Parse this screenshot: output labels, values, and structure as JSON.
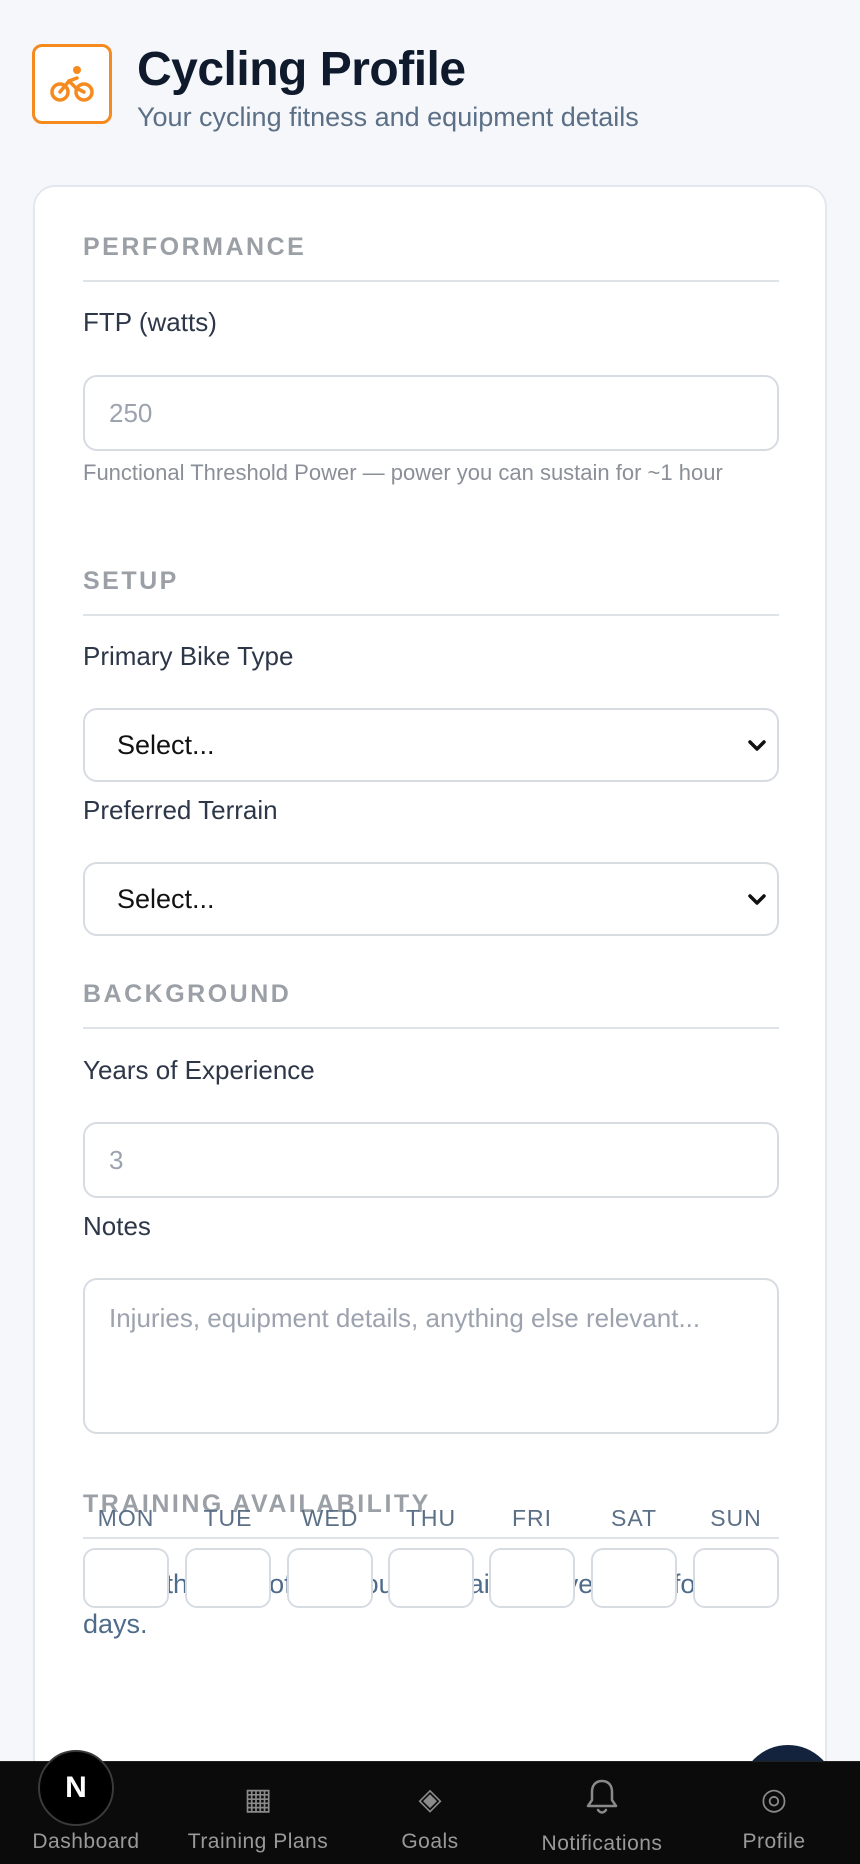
{
  "header": {
    "title": "Cycling Profile",
    "subtitle": "Your cycling fitness and equipment details",
    "icon": "bicycle-icon",
    "accent": "#f58a1f"
  },
  "form": {
    "performance": {
      "section_title": "PERFORMANCE",
      "ftp_label": "FTP (watts)",
      "ftp_placeholder": "250",
      "ftp_hint": "Functional Threshold Power — power you can sustain for ~1 hour"
    },
    "setup": {
      "section_title": "SETUP",
      "bike_type_label": "Primary Bike Type",
      "bike_type_value": "Select...",
      "terrain_label": "Preferred Terrain",
      "terrain_value": "Select..."
    },
    "background": {
      "section_title": "BACKGROUND",
      "years_label": "Years of Experience",
      "years_placeholder": "3",
      "notes_label": "Notes",
      "notes_placeholder": "Injuries, equipment details, anything else relevant..."
    },
    "availability": {
      "section_title": "TRAINING AVAILABILITY",
      "description": "Select the time of day you can train. Leave blank for rest days.",
      "days": [
        "MON",
        "TUE",
        "WED",
        "THU",
        "FRI",
        "SAT",
        "SUN"
      ]
    }
  },
  "nav": {
    "badge": "N",
    "items": [
      {
        "label": "Dashboard",
        "icon": "dashboard-icon"
      },
      {
        "label": "Training Plans",
        "icon": "grid-icon"
      },
      {
        "label": "Goals",
        "icon": "diamond-icon"
      },
      {
        "label": "Notifications",
        "icon": "bell-icon"
      },
      {
        "label": "Profile",
        "icon": "profile-icon"
      }
    ]
  }
}
